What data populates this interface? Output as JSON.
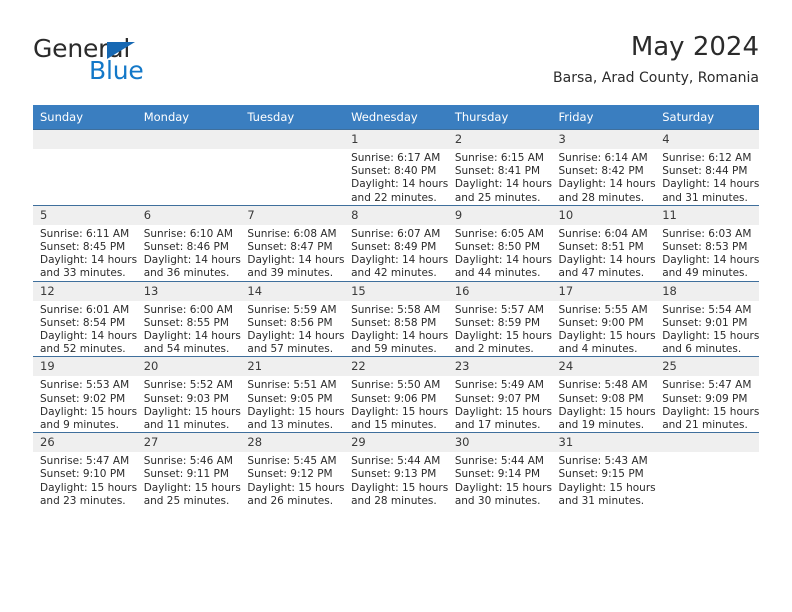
{
  "brand": {
    "word1": "General",
    "word2": "Blue",
    "triangle_color": "#1668b3",
    "word2_color": "#1378c8"
  },
  "header": {
    "title": "May 2024",
    "subtitle": "Barsa, Arad County, Romania"
  },
  "theme": {
    "header_bg": "#3a7ec0",
    "daynum_bg": "#efefef",
    "row_border": "#3f6f9c",
    "text": "#2b2b2b"
  },
  "weekdays": [
    "Sunday",
    "Monday",
    "Tuesday",
    "Wednesday",
    "Thursday",
    "Friday",
    "Saturday"
  ],
  "labels": {
    "sunrise": "Sunrise:",
    "sunset": "Sunset:",
    "daylight": "Daylight:"
  },
  "weeks": [
    [
      {
        "day": "",
        "empty": true
      },
      {
        "day": "",
        "empty": true
      },
      {
        "day": "",
        "empty": true
      },
      {
        "day": "1",
        "sunrise": "Sunrise: 6:17 AM",
        "sunset": "Sunset: 8:40 PM",
        "daylight1": "Daylight: 14 hours",
        "daylight2": "and 22 minutes."
      },
      {
        "day": "2",
        "sunrise": "Sunrise: 6:15 AM",
        "sunset": "Sunset: 8:41 PM",
        "daylight1": "Daylight: 14 hours",
        "daylight2": "and 25 minutes."
      },
      {
        "day": "3",
        "sunrise": "Sunrise: 6:14 AM",
        "sunset": "Sunset: 8:42 PM",
        "daylight1": "Daylight: 14 hours",
        "daylight2": "and 28 minutes."
      },
      {
        "day": "4",
        "sunrise": "Sunrise: 6:12 AM",
        "sunset": "Sunset: 8:44 PM",
        "daylight1": "Daylight: 14 hours",
        "daylight2": "and 31 minutes."
      }
    ],
    [
      {
        "day": "5",
        "sunrise": "Sunrise: 6:11 AM",
        "sunset": "Sunset: 8:45 PM",
        "daylight1": "Daylight: 14 hours",
        "daylight2": "and 33 minutes."
      },
      {
        "day": "6",
        "sunrise": "Sunrise: 6:10 AM",
        "sunset": "Sunset: 8:46 PM",
        "daylight1": "Daylight: 14 hours",
        "daylight2": "and 36 minutes."
      },
      {
        "day": "7",
        "sunrise": "Sunrise: 6:08 AM",
        "sunset": "Sunset: 8:47 PM",
        "daylight1": "Daylight: 14 hours",
        "daylight2": "and 39 minutes."
      },
      {
        "day": "8",
        "sunrise": "Sunrise: 6:07 AM",
        "sunset": "Sunset: 8:49 PM",
        "daylight1": "Daylight: 14 hours",
        "daylight2": "and 42 minutes."
      },
      {
        "day": "9",
        "sunrise": "Sunrise: 6:05 AM",
        "sunset": "Sunset: 8:50 PM",
        "daylight1": "Daylight: 14 hours",
        "daylight2": "and 44 minutes."
      },
      {
        "day": "10",
        "sunrise": "Sunrise: 6:04 AM",
        "sunset": "Sunset: 8:51 PM",
        "daylight1": "Daylight: 14 hours",
        "daylight2": "and 47 minutes."
      },
      {
        "day": "11",
        "sunrise": "Sunrise: 6:03 AM",
        "sunset": "Sunset: 8:53 PM",
        "daylight1": "Daylight: 14 hours",
        "daylight2": "and 49 minutes."
      }
    ],
    [
      {
        "day": "12",
        "sunrise": "Sunrise: 6:01 AM",
        "sunset": "Sunset: 8:54 PM",
        "daylight1": "Daylight: 14 hours",
        "daylight2": "and 52 minutes."
      },
      {
        "day": "13",
        "sunrise": "Sunrise: 6:00 AM",
        "sunset": "Sunset: 8:55 PM",
        "daylight1": "Daylight: 14 hours",
        "daylight2": "and 54 minutes."
      },
      {
        "day": "14",
        "sunrise": "Sunrise: 5:59 AM",
        "sunset": "Sunset: 8:56 PM",
        "daylight1": "Daylight: 14 hours",
        "daylight2": "and 57 minutes."
      },
      {
        "day": "15",
        "sunrise": "Sunrise: 5:58 AM",
        "sunset": "Sunset: 8:58 PM",
        "daylight1": "Daylight: 14 hours",
        "daylight2": "and 59 minutes."
      },
      {
        "day": "16",
        "sunrise": "Sunrise: 5:57 AM",
        "sunset": "Sunset: 8:59 PM",
        "daylight1": "Daylight: 15 hours",
        "daylight2": "and 2 minutes."
      },
      {
        "day": "17",
        "sunrise": "Sunrise: 5:55 AM",
        "sunset": "Sunset: 9:00 PM",
        "daylight1": "Daylight: 15 hours",
        "daylight2": "and 4 minutes."
      },
      {
        "day": "18",
        "sunrise": "Sunrise: 5:54 AM",
        "sunset": "Sunset: 9:01 PM",
        "daylight1": "Daylight: 15 hours",
        "daylight2": "and 6 minutes."
      }
    ],
    [
      {
        "day": "19",
        "sunrise": "Sunrise: 5:53 AM",
        "sunset": "Sunset: 9:02 PM",
        "daylight1": "Daylight: 15 hours",
        "daylight2": "and 9 minutes."
      },
      {
        "day": "20",
        "sunrise": "Sunrise: 5:52 AM",
        "sunset": "Sunset: 9:03 PM",
        "daylight1": "Daylight: 15 hours",
        "daylight2": "and 11 minutes."
      },
      {
        "day": "21",
        "sunrise": "Sunrise: 5:51 AM",
        "sunset": "Sunset: 9:05 PM",
        "daylight1": "Daylight: 15 hours",
        "daylight2": "and 13 minutes."
      },
      {
        "day": "22",
        "sunrise": "Sunrise: 5:50 AM",
        "sunset": "Sunset: 9:06 PM",
        "daylight1": "Daylight: 15 hours",
        "daylight2": "and 15 minutes."
      },
      {
        "day": "23",
        "sunrise": "Sunrise: 5:49 AM",
        "sunset": "Sunset: 9:07 PM",
        "daylight1": "Daylight: 15 hours",
        "daylight2": "and 17 minutes."
      },
      {
        "day": "24",
        "sunrise": "Sunrise: 5:48 AM",
        "sunset": "Sunset: 9:08 PM",
        "daylight1": "Daylight: 15 hours",
        "daylight2": "and 19 minutes."
      },
      {
        "day": "25",
        "sunrise": "Sunrise: 5:47 AM",
        "sunset": "Sunset: 9:09 PM",
        "daylight1": "Daylight: 15 hours",
        "daylight2": "and 21 minutes."
      }
    ],
    [
      {
        "day": "26",
        "sunrise": "Sunrise: 5:47 AM",
        "sunset": "Sunset: 9:10 PM",
        "daylight1": "Daylight: 15 hours",
        "daylight2": "and 23 minutes."
      },
      {
        "day": "27",
        "sunrise": "Sunrise: 5:46 AM",
        "sunset": "Sunset: 9:11 PM",
        "daylight1": "Daylight: 15 hours",
        "daylight2": "and 25 minutes."
      },
      {
        "day": "28",
        "sunrise": "Sunrise: 5:45 AM",
        "sunset": "Sunset: 9:12 PM",
        "daylight1": "Daylight: 15 hours",
        "daylight2": "and 26 minutes."
      },
      {
        "day": "29",
        "sunrise": "Sunrise: 5:44 AM",
        "sunset": "Sunset: 9:13 PM",
        "daylight1": "Daylight: 15 hours",
        "daylight2": "and 28 minutes."
      },
      {
        "day": "30",
        "sunrise": "Sunrise: 5:44 AM",
        "sunset": "Sunset: 9:14 PM",
        "daylight1": "Daylight: 15 hours",
        "daylight2": "and 30 minutes."
      },
      {
        "day": "31",
        "sunrise": "Sunrise: 5:43 AM",
        "sunset": "Sunset: 9:15 PM",
        "daylight1": "Daylight: 15 hours",
        "daylight2": "and 31 minutes."
      },
      {
        "day": "",
        "empty": true
      }
    ]
  ]
}
